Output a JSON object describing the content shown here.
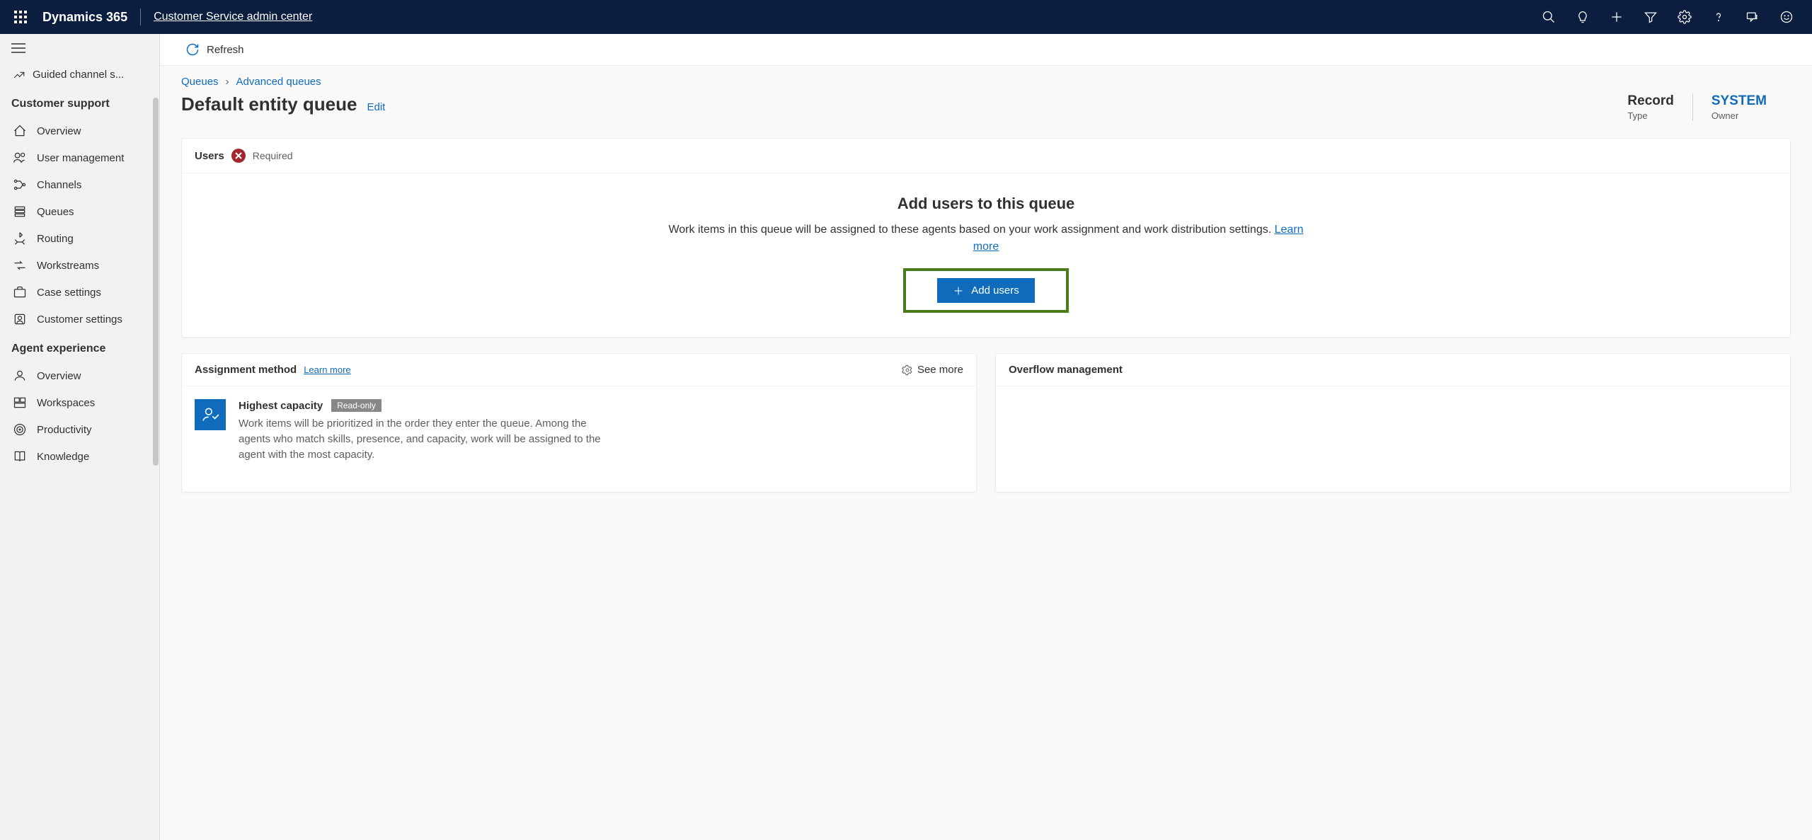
{
  "header": {
    "brand": "Dynamics 365",
    "app": "Customer Service admin center"
  },
  "sidebar": {
    "truncated_item": "Guided channel s...",
    "section1_title": "Customer support",
    "section1_items": [
      "Overview",
      "User management",
      "Channels",
      "Queues",
      "Routing",
      "Workstreams",
      "Case settings",
      "Customer settings"
    ],
    "section2_title": "Agent experience",
    "section2_items": [
      "Overview",
      "Workspaces",
      "Productivity",
      "Knowledge"
    ]
  },
  "commandbar": {
    "refresh": "Refresh"
  },
  "breadcrumb": {
    "first": "Queues",
    "second": "Advanced queues"
  },
  "page": {
    "title": "Default entity queue",
    "edit": "Edit",
    "meta_record_value": "Record",
    "meta_record_label": "Type",
    "meta_owner_value": "SYSTEM",
    "meta_owner_label": "Owner"
  },
  "users_card": {
    "title": "Users",
    "required": "Required",
    "empty_title": "Add users to this queue",
    "empty_desc": "Work items in this queue will be assigned to these agents based on your work assignment and work distribution settings. ",
    "learn_more": "Learn more",
    "button": "Add users"
  },
  "assignment_card": {
    "title": "Assignment method",
    "learn_more": "Learn more",
    "see_more": "See more",
    "method_name": "Highest capacity",
    "readonly": "Read-only",
    "method_desc": "Work items will be prioritized in the order they enter the queue. Among the agents who match skills, presence, and capacity, work will be assigned to the agent with the most capacity."
  },
  "overflow_card": {
    "title": "Overflow management"
  }
}
